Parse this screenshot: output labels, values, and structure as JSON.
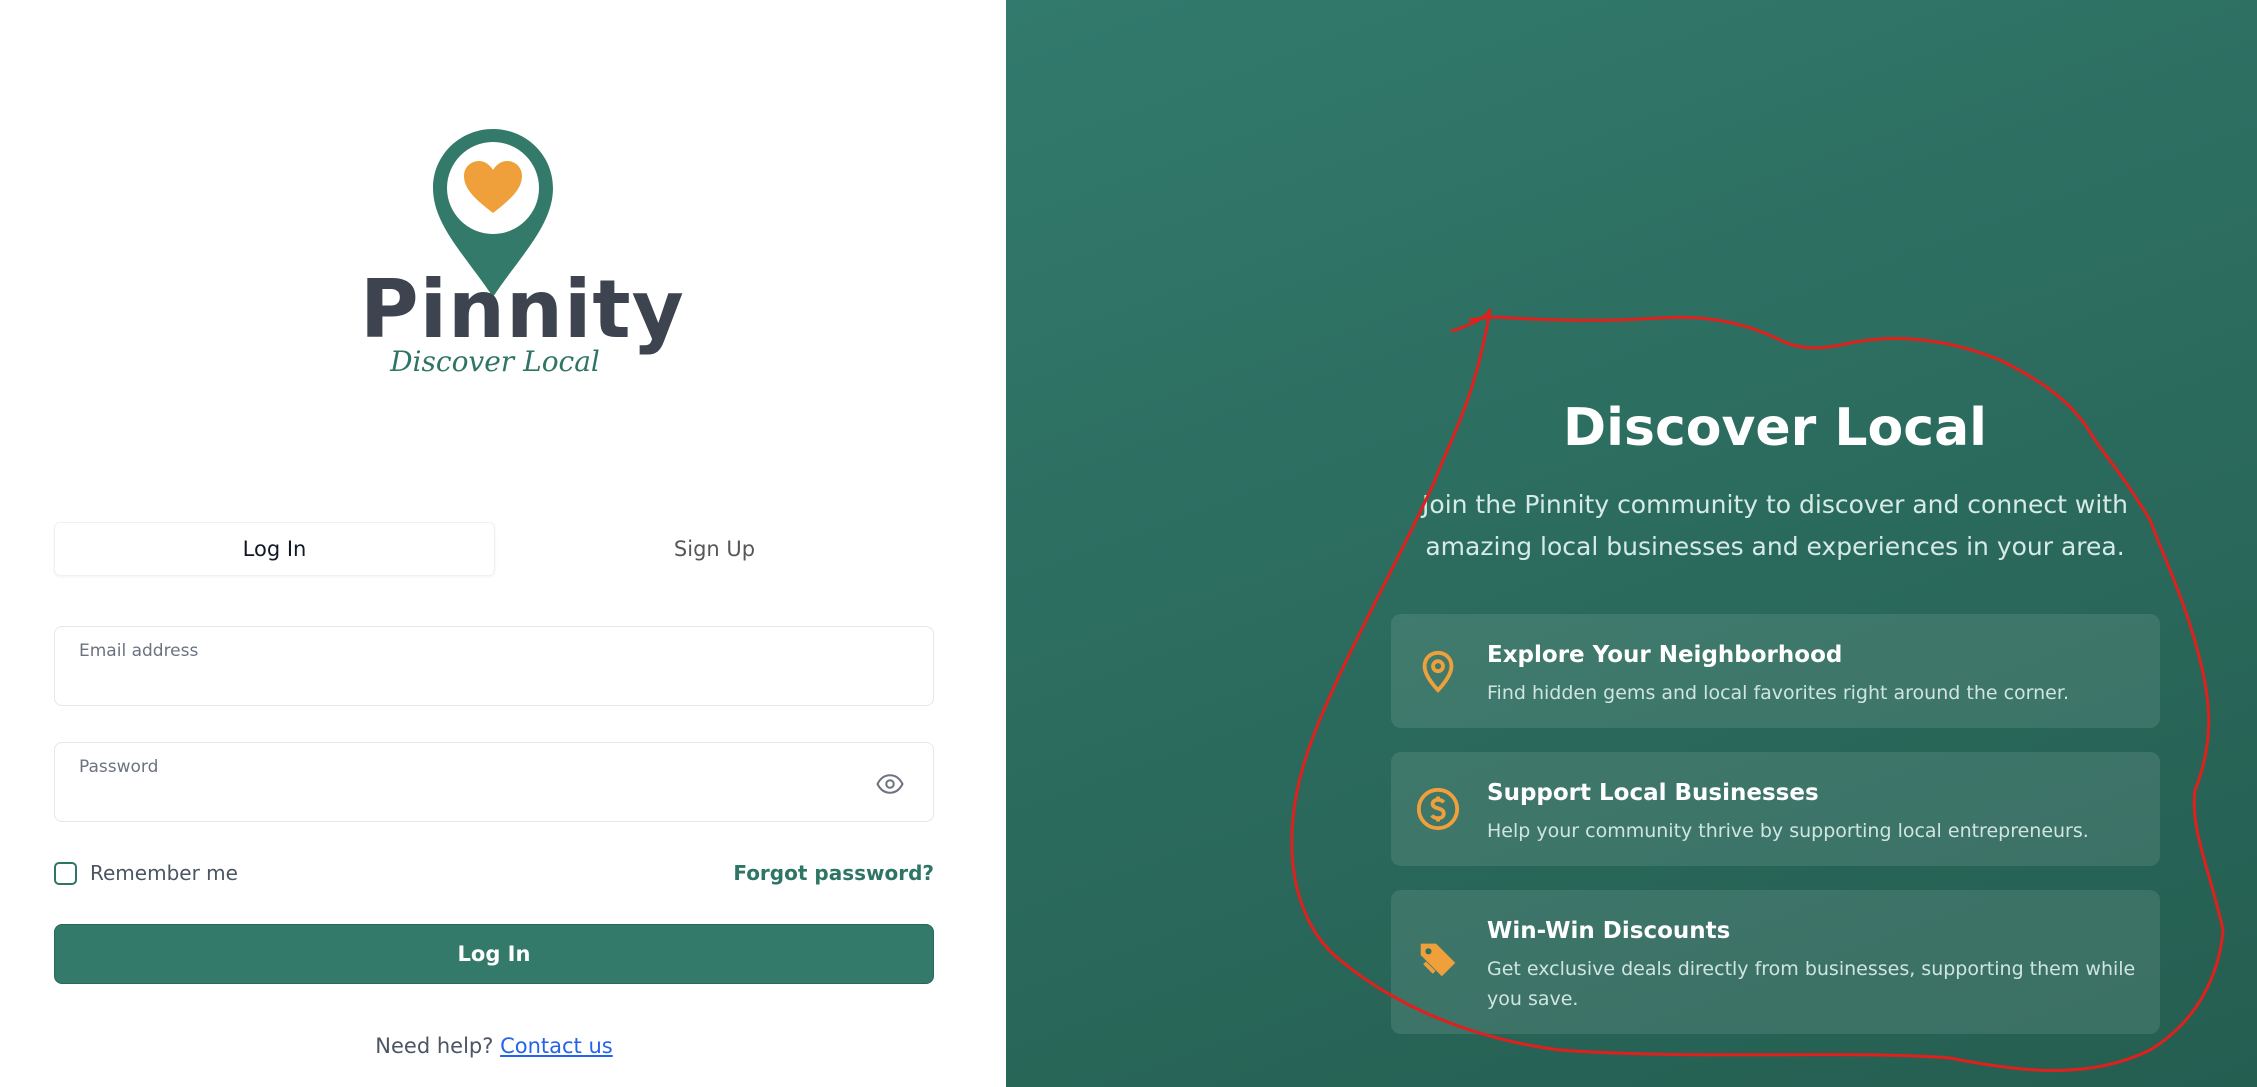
{
  "brand": {
    "name": "Pinnity",
    "tagline": "Discover Local"
  },
  "auth_tabs": [
    {
      "label": "Log In",
      "active": true
    },
    {
      "label": "Sign Up",
      "active": false
    }
  ],
  "form": {
    "email_label": "Email address",
    "email_value": "",
    "password_label": "Password",
    "password_value": "",
    "remember_label": "Remember me",
    "remember_checked": false,
    "forgot_label": "Forgot password?",
    "submit_label": "Log In"
  },
  "help": {
    "prefix": "Need help?",
    "link_label": "Contact us"
  },
  "promo": {
    "title": "Discover Local",
    "subtitle": "Join the Pinnity community to discover and connect with amazing local businesses and experiences in your area.",
    "features": [
      {
        "icon": "map-pin-icon",
        "title": "Explore Your Neighborhood",
        "description": "Find hidden gems and local favorites right around the corner."
      },
      {
        "icon": "dollar-coin-icon",
        "title": "Support Local Businesses",
        "description": "Help your community thrive by supporting local entrepreneurs."
      },
      {
        "icon": "tag-icon",
        "title": "Win-Win Discounts",
        "description": "Get exclusive deals directly from businesses, supporting them while you save."
      }
    ]
  },
  "colors": {
    "brand_teal": "#347a6b",
    "accent_orange": "#f0a03a",
    "logo_text": "#3d4450",
    "annotation_red": "#e0201c"
  }
}
